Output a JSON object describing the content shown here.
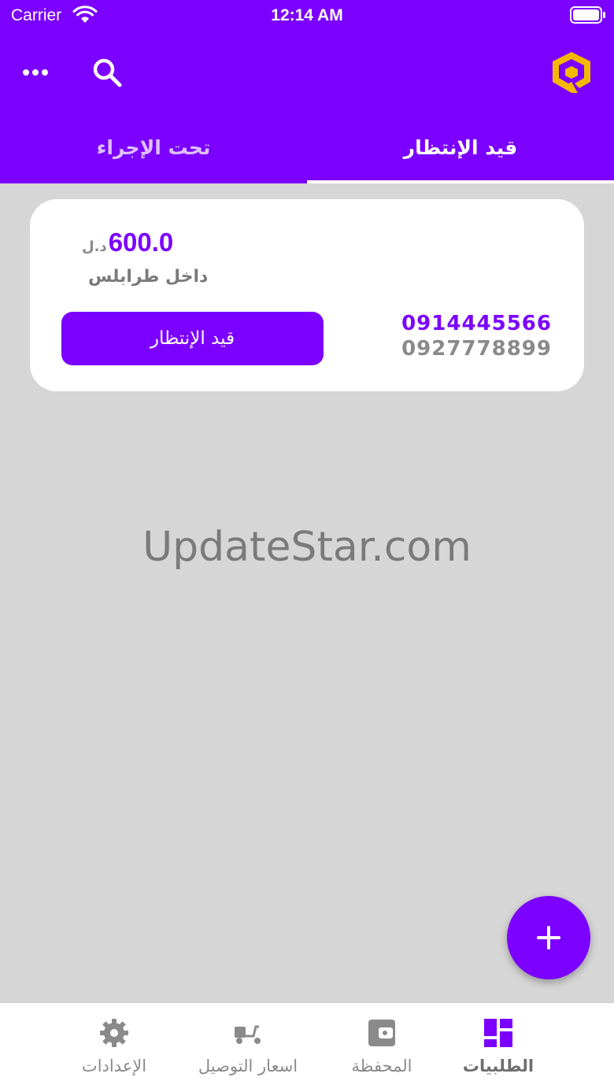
{
  "status_bar": {
    "carrier": "Carrier",
    "time": "12:14 AM"
  },
  "header": {
    "icons": [
      "more-icon",
      "search-icon",
      "logo-icon"
    ],
    "tabs": [
      {
        "label": "قيد الإنتظار",
        "active": true
      },
      {
        "label": "تحت الإجراء",
        "active": false
      }
    ]
  },
  "order": {
    "price": "600.0",
    "currency": "د.ل",
    "area": "داخل طرابلس",
    "status_label": "قيد الإنتظار",
    "phone_primary": "0914445566",
    "phone_secondary": "0927778899"
  },
  "watermark": "UpdateStar.com",
  "fab": {
    "icon": "plus-icon"
  },
  "bottom_nav": {
    "items": [
      {
        "label": "الطلبيات",
        "icon": "orders-grid-icon",
        "active": true
      },
      {
        "label": "المحفظة",
        "icon": "wallet-icon",
        "active": false
      },
      {
        "label": "اسعار التوصيل",
        "icon": "delivery-scooter-icon",
        "active": false
      },
      {
        "label": "الإعدادات",
        "icon": "gear-icon",
        "active": false
      }
    ]
  },
  "colors": {
    "primary": "#7b00ff",
    "background": "#d6d6d6",
    "card": "#ffffff",
    "logo": "#f5b800",
    "muted_text": "#8a8a8a"
  }
}
